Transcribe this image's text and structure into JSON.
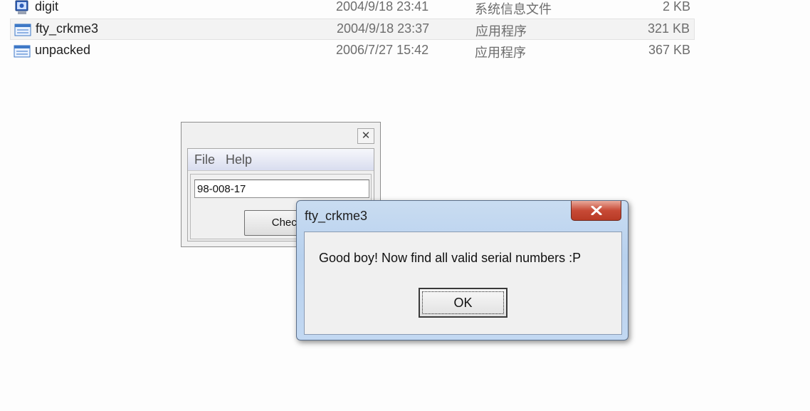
{
  "files": [
    {
      "name": "digit",
      "date": "2004/9/18 23:41",
      "type": "系统信息文件",
      "size": "2 KB",
      "icon": "system-info-file-icon",
      "selected": false
    },
    {
      "name": "fty_crkme3",
      "date": "2004/9/18 23:37",
      "type": "应用程序",
      "size": "321 KB",
      "icon": "application-icon",
      "selected": true
    },
    {
      "name": "unpacked",
      "date": "2006/7/27 15:42",
      "type": "应用程序",
      "size": "367 KB",
      "icon": "application-icon",
      "selected": false
    }
  ],
  "crackme": {
    "menu_file": "File",
    "menu_help": "Help",
    "serial_value": "98-008-17",
    "check_label": "Check"
  },
  "msgbox": {
    "title": "fty_crkme3",
    "message": "Good boy! Now find all valid serial numbers :P",
    "ok_label": "OK"
  },
  "colors": {
    "close_red": "#c74a36",
    "title_blue": "#b8d1ee"
  }
}
